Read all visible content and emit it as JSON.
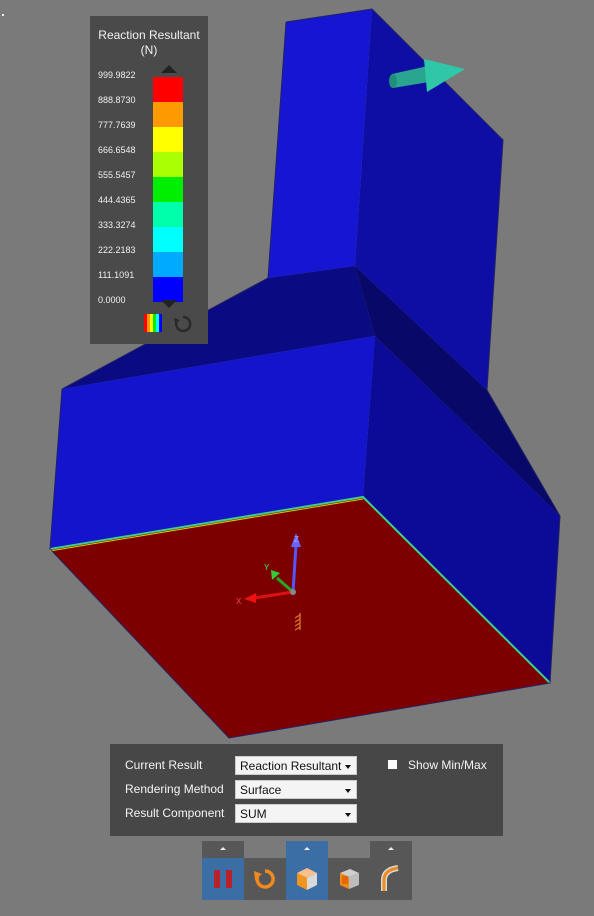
{
  "legend": {
    "title_line1": "Reaction Resultant",
    "title_line2": "(N)",
    "values": [
      "999.9822",
      "888.8730",
      "777.7639",
      "666.6548",
      "555.5457",
      "444.4365",
      "333.3274",
      "222.2183",
      "111.1091",
      "0.0000"
    ],
    "colors": [
      "#ff0000",
      "#ff9900",
      "#ffff00",
      "#aaff00",
      "#00ee00",
      "#00ffaa",
      "#00ffff",
      "#00aaff",
      "#0000ff"
    ],
    "rainbow_icon": "rainbow-icon",
    "reset_icon": "reset-icon"
  },
  "model": {
    "colors": {
      "blue_front": "#1414cf",
      "blue_side": "#0b0b9a",
      "blue_dark": "#07077a",
      "red": "#7d0000"
    },
    "triad": {
      "x": "X",
      "y": "Y",
      "z": "Z"
    }
  },
  "result_panel": {
    "current_result_label": "Current Result",
    "current_result_value": "Reaction Resultant",
    "rendering_method_label": "Rendering Method",
    "rendering_method_value": "Surface",
    "result_component_label": "Result Component",
    "result_component_value": "SUM",
    "show_minmax_label": "Show Min/Max",
    "show_minmax_checked": false
  },
  "toolbar": {
    "buttons": [
      {
        "name": "pause-button",
        "icon": "pause-icon",
        "active": true
      },
      {
        "name": "reset-view-button",
        "icon": "rotate-icon",
        "active": false
      },
      {
        "name": "shaded-view-button",
        "icon": "shaded-cube-icon",
        "active": true
      },
      {
        "name": "section-view-button",
        "icon": "cube-section-icon",
        "active": false
      },
      {
        "name": "deformation-button",
        "icon": "deformation-icon",
        "active": false
      }
    ]
  }
}
